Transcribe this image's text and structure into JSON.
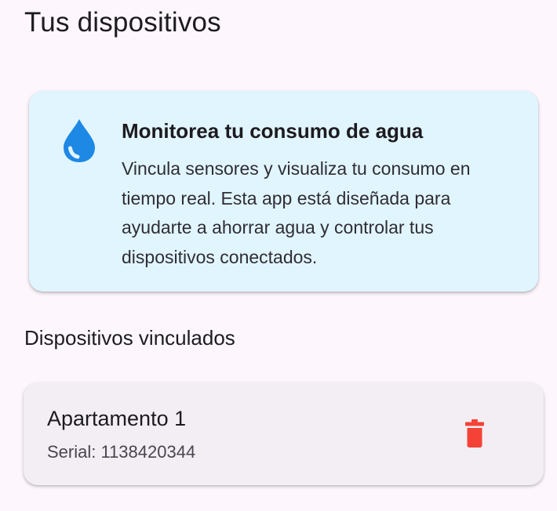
{
  "header": {
    "title": "Tus dispositivos"
  },
  "info_card": {
    "icon": "water-drop-icon",
    "title": "Monitorea tu consumo de agua",
    "description": "Vincula sensores y visualiza tu consumo en tiempo real. Esta app está diseñada para ayudarte a ahorrar agua y controlar tus dispositivos conectados.",
    "background_color": "#e1f5fe",
    "icon_color": "#1e88e5"
  },
  "devices_section": {
    "heading": "Dispositivos vinculados",
    "devices": [
      {
        "name": "Apartamento 1",
        "serial_label": "Serial: 1138420344",
        "action_icon": "trash-icon",
        "action_color": "#f44336"
      }
    ]
  },
  "colors": {
    "page_background": "#fdf7fd",
    "device_card_background": "#f3eef4"
  }
}
